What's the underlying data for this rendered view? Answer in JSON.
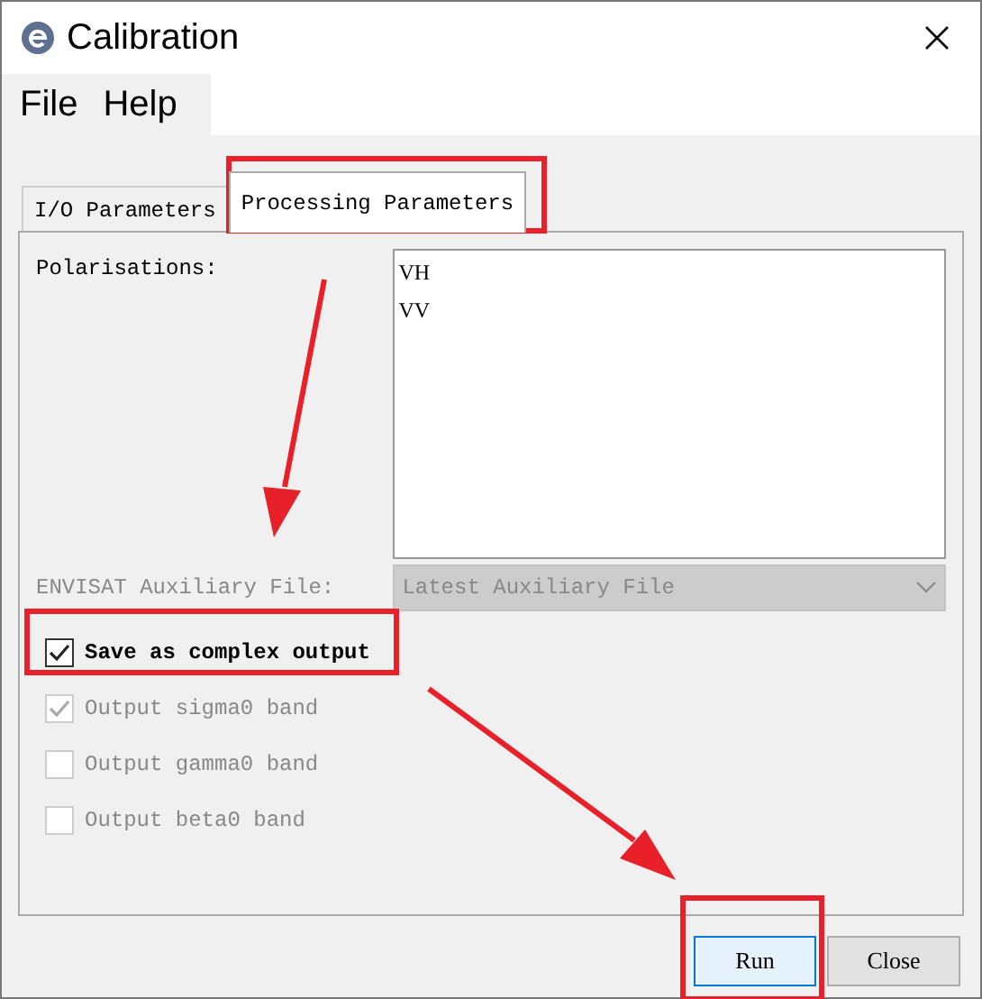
{
  "window": {
    "title": "Calibration"
  },
  "menu": [
    "File",
    "Help"
  ],
  "tabs": [
    {
      "label": "I/O Parameters",
      "selected": false
    },
    {
      "label": "Processing Parameters",
      "selected": true
    }
  ],
  "polarisations": {
    "label": "Polarisations:",
    "items": [
      "VH",
      "VV"
    ]
  },
  "auxiliary_file": {
    "label": "ENVISAT Auxiliary File:",
    "value": "Latest Auxiliary File",
    "disabled": true
  },
  "checkboxes": [
    {
      "label": "Save as complex output",
      "checked": true,
      "disabled": false
    },
    {
      "label": "Output sigma0 band",
      "checked": true,
      "disabled": true
    },
    {
      "label": "Output gamma0 band",
      "checked": false,
      "disabled": true
    },
    {
      "label": "Output beta0 band",
      "checked": false,
      "disabled": true
    }
  ],
  "buttons": [
    {
      "label": "Run",
      "default": true
    },
    {
      "label": "Close",
      "default": false
    }
  ]
}
